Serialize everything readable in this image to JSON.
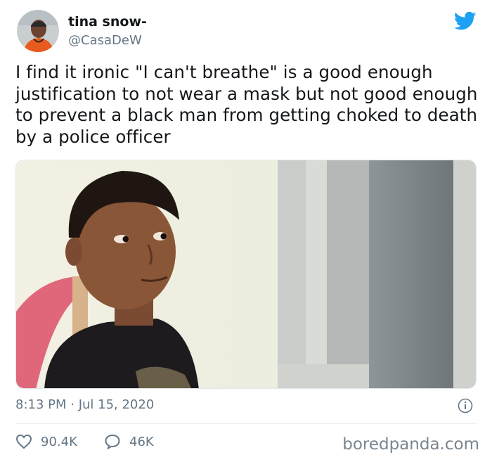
{
  "author": {
    "display_name": "tina snow-",
    "handle": "@CasaDeW",
    "avatar": "profile-photo"
  },
  "tweet": {
    "text": "I find it ironic \"I can't breathe\" is a good enough justification to not wear a mask but not good enough to prevent a black man from getting choked to death by a police officer",
    "timestamp": "8:13 PM · Jul 15, 2020"
  },
  "media": {
    "type": "photo",
    "subject": "child-looking-sideways"
  },
  "stats": {
    "likes": "90.4K",
    "replies": "46K"
  },
  "icons": {
    "brand": "twitter-bird-icon",
    "like": "heart-icon",
    "reply": "speech-bubble-icon",
    "info": "info-icon"
  },
  "colors": {
    "twitter_blue": "#1da1f2",
    "secondary_text": "#657786"
  },
  "watermark": "boredpanda.com"
}
